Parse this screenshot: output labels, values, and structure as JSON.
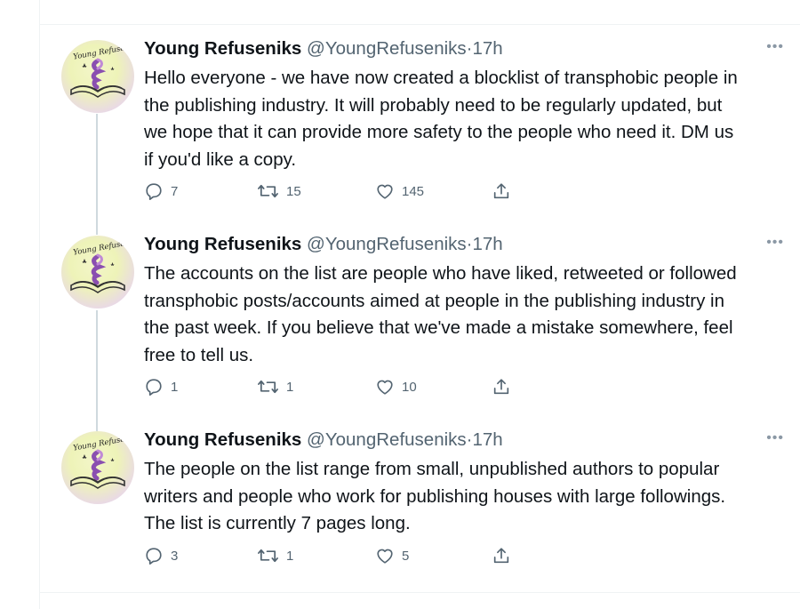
{
  "tweets": [
    {
      "name": "Young Refuseniks",
      "handle": "@YoungRefuseniks",
      "separator": "·",
      "time": "17h",
      "avatar_text": "Young Refuseniks",
      "lines": [
        "Hello everyone - we have now created a blocklist of transphobic people in",
        "the publishing industry. It will probably need to be regularly updated, but",
        "we hope that it can provide more safety to the people who need it. DM us",
        "if you'd like a copy."
      ],
      "replies": "7",
      "retweets": "15",
      "likes": "145"
    },
    {
      "name": "Young Refuseniks",
      "handle": "@YoungRefuseniks",
      "separator": "·",
      "time": "17h",
      "avatar_text": "Young Refuseniks",
      "lines": [
        "The accounts on the list are people who have liked, retweeted or followed",
        "transphobic posts/accounts aimed at people in the publishing industry in",
        "the past week. If you believe that we've made a mistake somewhere, feel",
        "free to tell us."
      ],
      "replies": "1",
      "retweets": "1",
      "likes": "10"
    },
    {
      "name": "Young Refuseniks",
      "handle": "@YoungRefuseniks",
      "separator": "·",
      "time": "17h",
      "avatar_text": "Young Refuseniks",
      "lines": [
        "The people on the list range from small, unpublished authors to popular",
        "writers and people who work for publishing houses with large followings.",
        "The list is currently 7 pages long."
      ],
      "replies": "3",
      "retweets": "1",
      "likes": "5"
    }
  ],
  "icons": {
    "more": "more-icon",
    "reply": "reply-icon",
    "retweet": "retweet-icon",
    "like": "heart-icon",
    "share": "share-icon"
  },
  "colors": {
    "text": "#0f1419",
    "secondary": "#536471",
    "divider": "#eff3f4",
    "thread_line": "#cfd9de"
  }
}
